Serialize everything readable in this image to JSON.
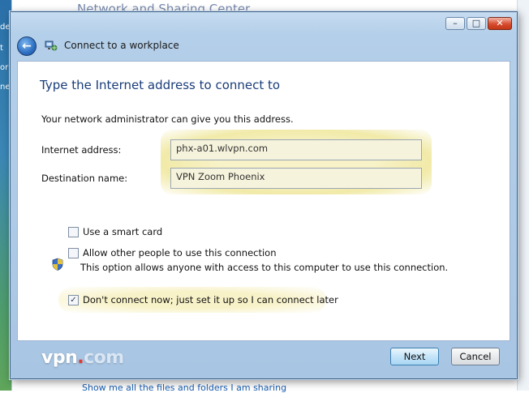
{
  "background": {
    "title": "Network and Sharing Center",
    "bottom_link": "Show me all the files and folders I am sharing",
    "left_fragments": [
      "de",
      "t",
      "or",
      "ne"
    ]
  },
  "window": {
    "caption_buttons": {
      "minimize": "–",
      "maximize": "□",
      "close": "✕"
    },
    "nav_title": "Connect to a workplace"
  },
  "page": {
    "heading": "Type the Internet address to connect to",
    "admin_hint": "Your network administrator can give you this address.",
    "internet_address_label": "Internet address:",
    "internet_address_value": "phx-a01.wlvpn.com",
    "destination_label": "Destination name:",
    "destination_value": "VPN Zoom Phoenix"
  },
  "options": {
    "smart_card": {
      "label": "Use a smart card",
      "checked": false
    },
    "allow_others": {
      "label": "Allow other people to use this connection",
      "description": "This option allows anyone with access to this computer to use this connection.",
      "checked": false
    },
    "dont_connect": {
      "label": "Don't connect now; just set it up so I can connect later",
      "checked": true
    }
  },
  "footer": {
    "logo_vpn": "vpn",
    "logo_dot": ".",
    "logo_com": "com",
    "next_label": "Next",
    "cancel_label": "Cancel"
  },
  "colors": {
    "heading": "#1a3d7a",
    "highlight": "#f1eaa8",
    "frame": "#b4cfe9"
  }
}
